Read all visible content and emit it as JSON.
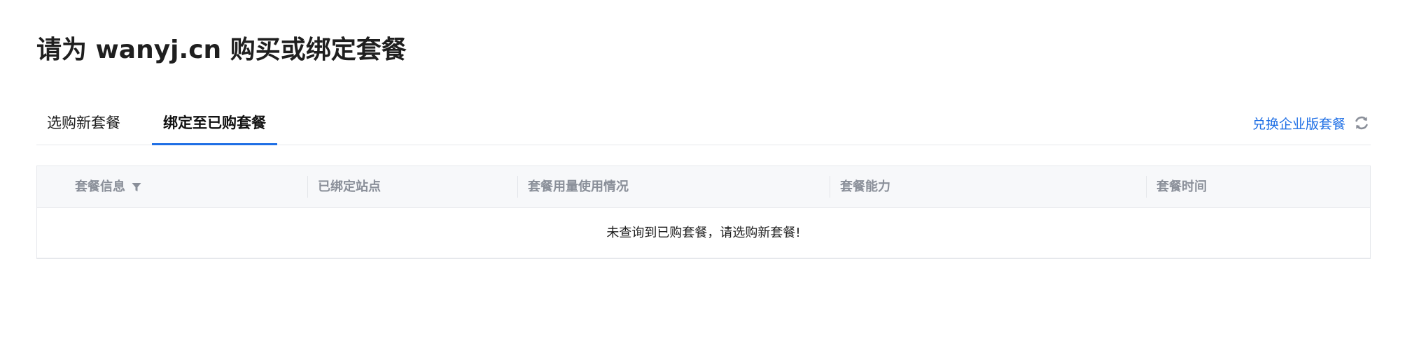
{
  "page": {
    "title": "请为 wanyj.cn 购买或绑定套餐"
  },
  "tabs": [
    {
      "label": "选购新套餐",
      "active": false
    },
    {
      "label": "绑定至已购套餐",
      "active": true
    }
  ],
  "exchange": {
    "label": "兑换企业版套餐",
    "icon": "refresh-icon"
  },
  "table": {
    "columns": [
      {
        "label": "套餐信息",
        "icon": "filter-icon"
      },
      {
        "label": "已绑定站点"
      },
      {
        "label": "套餐用量使用情况"
      },
      {
        "label": "套餐能力"
      },
      {
        "label": "套餐时间"
      }
    ],
    "empty_message": "未查询到已购套餐，请选购新套餐!"
  },
  "colors": {
    "accent": "#1f6fe5",
    "header_bg": "#f7f8fa",
    "header_text": "#8a8f99",
    "border": "#e6e8ec"
  }
}
